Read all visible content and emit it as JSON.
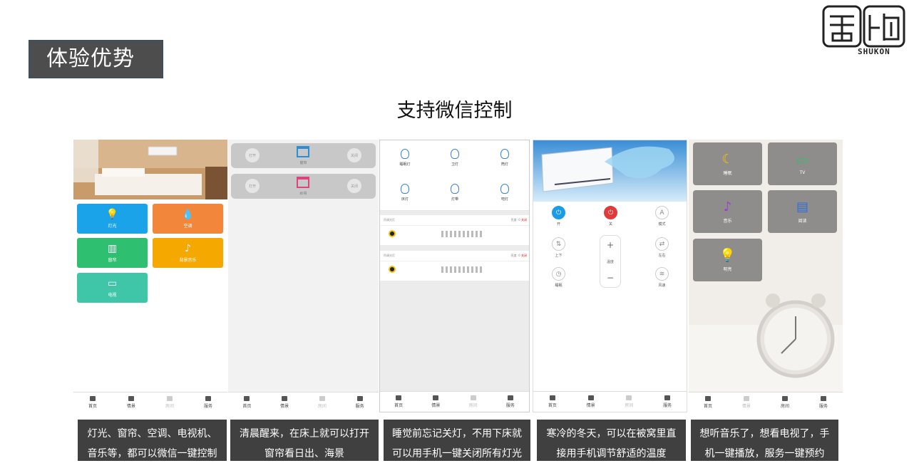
{
  "header": {
    "title": "体验优势",
    "logo_text": "SHUKON"
  },
  "subtitle": "支持微信控制",
  "screen1": {
    "tiles": [
      {
        "label": "灯光",
        "icon": "bulb-icon",
        "color": "#1aa3e8"
      },
      {
        "label": "空调",
        "icon": "drop-icon",
        "color": "#f2863a"
      },
      {
        "label": "窗帘",
        "icon": "curtain-icon",
        "color": "#2fbf71"
      },
      {
        "label": "背景音乐",
        "icon": "music-icon",
        "color": "#f5a800"
      },
      {
        "label": "电视",
        "icon": "tv-icon",
        "color": "#3fc6a8"
      }
    ]
  },
  "screen2": {
    "cards": [
      {
        "left": "打开",
        "label": "窗帘",
        "right": "关闭"
      },
      {
        "left": "打开",
        "label": "纱帘",
        "right": "关闭"
      }
    ]
  },
  "screen3": {
    "lamps": [
      "睡眠灯",
      "卫灯",
      "筒灯",
      "床灯",
      "灯带",
      "吧灯"
    ],
    "dimmers": [
      {
        "title": "吊调光灯",
        "brightness": "亮度: 0",
        "off": "关闭"
      },
      {
        "title": "吊调光灯",
        "brightness": "亮度: 0",
        "off": "关闭"
      }
    ]
  },
  "screen4": {
    "buttons": {
      "on": "开",
      "off": "关",
      "mode": "模式",
      "updown": "上下",
      "leftright": "左右",
      "timer": "睡眠",
      "wind": "风速",
      "temp": "温度",
      "plus": "+",
      "minus": "−",
      "a": "A"
    }
  },
  "screen5": {
    "tiles": [
      {
        "label": "睡眠",
        "icon": "moon-icon"
      },
      {
        "label": "TV",
        "icon": "tv-icon"
      },
      {
        "label": "音乐",
        "icon": "music-icon"
      },
      {
        "label": "阅读",
        "icon": "book-icon"
      },
      {
        "label": "明亮",
        "icon": "bulb-icon"
      }
    ]
  },
  "nav": {
    "home": "首页",
    "scene": "情景",
    "grid": "房间",
    "service": "服务"
  },
  "captions": [
    [
      "灯光、窗帘、空调、电视机、",
      "音乐等，都可以微信一键控制"
    ],
    [
      "清晨醒来，在床上就可以打开",
      "窗帘看日出、海景"
    ],
    [
      "睡觉前忘记关灯，不用下床就",
      "可以用手机一键关闭所有灯光"
    ],
    [
      "寒冷的冬天，可以在被窝里直",
      "接用手机调节舒适的温度"
    ],
    [
      "想听音乐了，想看电视了，手",
      "机一键播放，服务一键预约"
    ]
  ]
}
